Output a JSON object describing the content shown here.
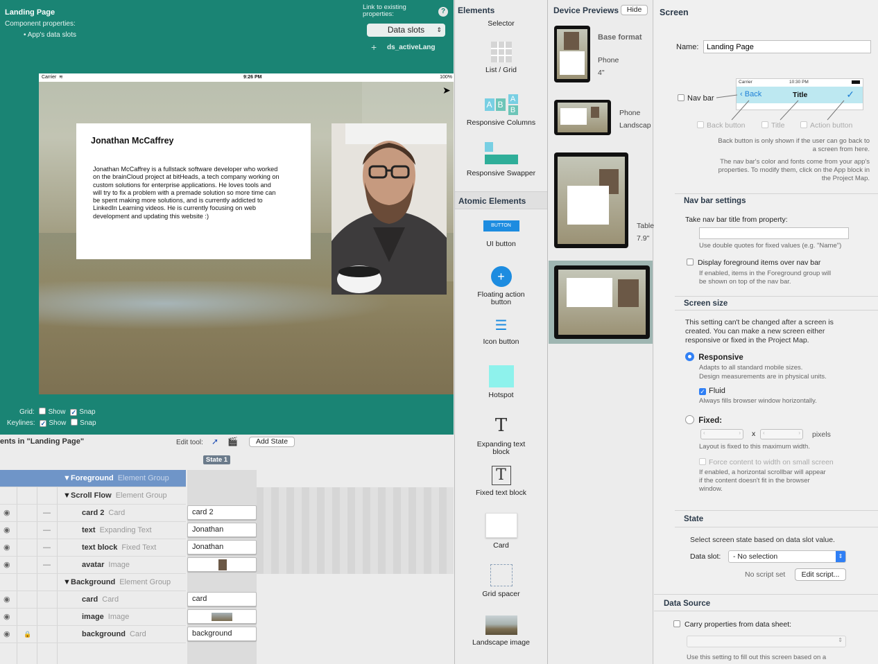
{
  "canvas": {
    "title": "Landing Page",
    "component_properties": "Component properties:",
    "data_slots_bullet": "• App's data slots",
    "link_label": "Link to existing properties:",
    "data_slots_button": "Data slots",
    "data_slot_item": "ds_activeLang",
    "help": "?"
  },
  "phone": {
    "carrier": "Carrier",
    "time": "9:26 PM",
    "battery": "100%",
    "card_title": "Jonathan McCaffrey",
    "card_body": "Jonathan McCaffrey is a fullstack software developer who worked on the brainCloud project at bitHeads, a tech company working on custom solutions for enterprise applications. He loves tools and will try to fix a problem with a premade solution so more time can be spent making more solutions, and is currently addicted to LinkedIn Learning videos. He is currently focusing on web development and updating this website :)"
  },
  "grid_controls": {
    "grid_label": "Grid:",
    "keylines_label": "Keylines:",
    "show": "Show",
    "snap": "Snap",
    "grid_show": false,
    "grid_snap": true,
    "keylines_show": true,
    "keylines_snap": false
  },
  "tree": {
    "header": "ents in \"Landing Page\"",
    "edit_tool": "Edit tool:",
    "add_state": "Add State",
    "state_badge": "State 1",
    "rows": [
      {
        "name": "Foreground",
        "type": "Element Group"
      },
      {
        "name": "Scroll Flow",
        "type": "Element Group"
      },
      {
        "name": "card 2",
        "type": "Card",
        "cell": "card 2"
      },
      {
        "name": "text",
        "type": "Expanding Text",
        "cell": "Jonathan"
      },
      {
        "name": "text block",
        "type": "Fixed Text",
        "cell": "Jonathan"
      },
      {
        "name": "avatar",
        "type": "Image"
      },
      {
        "name": "Background",
        "type": "Element Group"
      },
      {
        "name": "card",
        "type": "Card",
        "cell": "card"
      },
      {
        "name": "image",
        "type": "Image"
      },
      {
        "name": "background",
        "type": "Card",
        "cell": "background"
      }
    ]
  },
  "elements": {
    "header": "Elements",
    "atomic_header": "Atomic Elements",
    "items": {
      "selector": "Selector",
      "list_grid": "List / Grid",
      "responsive_columns": "Responsive Columns",
      "responsive_swapper": "Responsive Swapper",
      "ui_button": "UI button",
      "ui_button_text": "BUTTON",
      "fab": "Floating action button",
      "icon_button": "Icon button",
      "hotspot": "Hotspot",
      "expanding_text": "Expanding text block",
      "fixed_text": "Fixed text block",
      "card": "Card",
      "grid_spacer": "Grid spacer",
      "landscape_image": "Landscape image"
    }
  },
  "previews": {
    "header": "Device Previews",
    "hide": "Hide",
    "base_format": "Base format",
    "phone": "Phone",
    "phone_size": "4\"",
    "phone_landscape": "Phone",
    "landscape": "Landscap",
    "tablet": "Table",
    "tablet_size": "7.9\""
  },
  "props": {
    "title": "Screen",
    "name_label": "Name:",
    "name_value": "Landing Page",
    "nav_bar": "Nav bar",
    "nav_mock": {
      "carrier": "Carrier",
      "time": "10:30 PM",
      "back": "Back",
      "title": "Title"
    },
    "back_button": "Back button",
    "title_cb": "Title",
    "action_button": "Action button",
    "nav_note1": "Back button is only shown if the user can go back to a screen from here.",
    "nav_note2": "The nav bar's color and fonts come from your app's properties. To modify them, click on the App block in the Project Map.",
    "nav_settings": "Nav bar settings",
    "take_title": "Take nav bar title from property:",
    "quotes_note": "Use double quotes for fixed values (e.g. \"Name\")",
    "display_fg": "Display foreground items over nav bar",
    "fg_note": "If enabled, items in the Foreground group will be shown on top of the nav bar.",
    "screen_size": "Screen size",
    "size_note": "This setting can't be changed after a screen is created. You can make a new screen either responsive or fixed in the Project Map.",
    "responsive": "Responsive",
    "responsive_note1": "Adapts to all standard mobile sizes.",
    "responsive_note2": "Design measurements are in physical units.",
    "fluid": "Fluid",
    "fluid_note": "Always fills browser window horizontally.",
    "fixed": "Fixed:",
    "x": "x",
    "pixels": "pixels",
    "fixed_note": "Layout is fixed to this maximum width.",
    "force": "Force content to width on small screen",
    "force_note": "If enabled, a horizontal scrollbar will appear if the content doesn't fit in the browser window.",
    "state": "State",
    "state_note": "Select screen state based on data slot value.",
    "data_slot": "Data slot:",
    "no_selection": "- No selection",
    "no_script": "No script set",
    "edit_script": "Edit script...",
    "data_source": "Data Source",
    "carry": "Carry properties from data sheet:",
    "ds_note": "Use this setting to fill out this screen based on a"
  }
}
